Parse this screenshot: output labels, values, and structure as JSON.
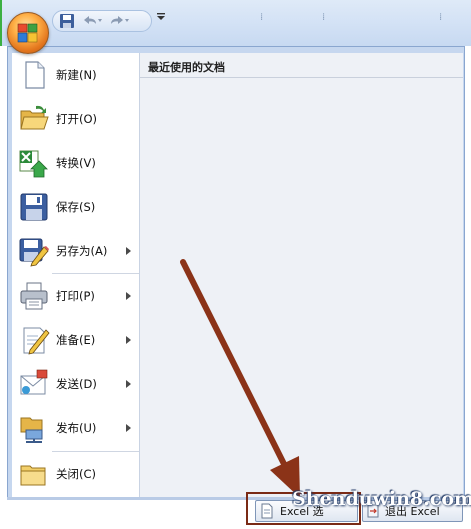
{
  "menu": {
    "items": [
      {
        "label": "新建(N)",
        "has_submenu": false,
        "icon": "new-document-icon"
      },
      {
        "label": "打开(O)",
        "has_submenu": false,
        "icon": "open-folder-icon"
      },
      {
        "label": "转换(V)",
        "has_submenu": false,
        "icon": "convert-excel-icon"
      },
      {
        "label": "保存(S)",
        "has_submenu": false,
        "icon": "save-disk-icon"
      },
      {
        "label": "另存为(A)",
        "has_submenu": true,
        "icon": "save-as-icon"
      },
      {
        "label": "打印(P)",
        "has_submenu": true,
        "icon": "printer-icon"
      },
      {
        "label": "准备(E)",
        "has_submenu": true,
        "icon": "prepare-icon"
      },
      {
        "label": "发送(D)",
        "has_submenu": true,
        "icon": "send-icon"
      },
      {
        "label": "发布(U)",
        "has_submenu": true,
        "icon": "publish-icon"
      },
      {
        "label": "关闭(C)",
        "has_submenu": false,
        "icon": "close-folder-icon"
      }
    ]
  },
  "recent": {
    "title": "最近使用的文档"
  },
  "footer": {
    "options_label": "Excel 选",
    "exit_label": "退出 Excel"
  },
  "watermark": "Shenduwin8.com",
  "colors": {
    "ribbon": "#d2e1f5",
    "menu_frame": "#c6d7ef",
    "annotation_arrow": "#8b3318",
    "office_orb": "#e2741c"
  }
}
